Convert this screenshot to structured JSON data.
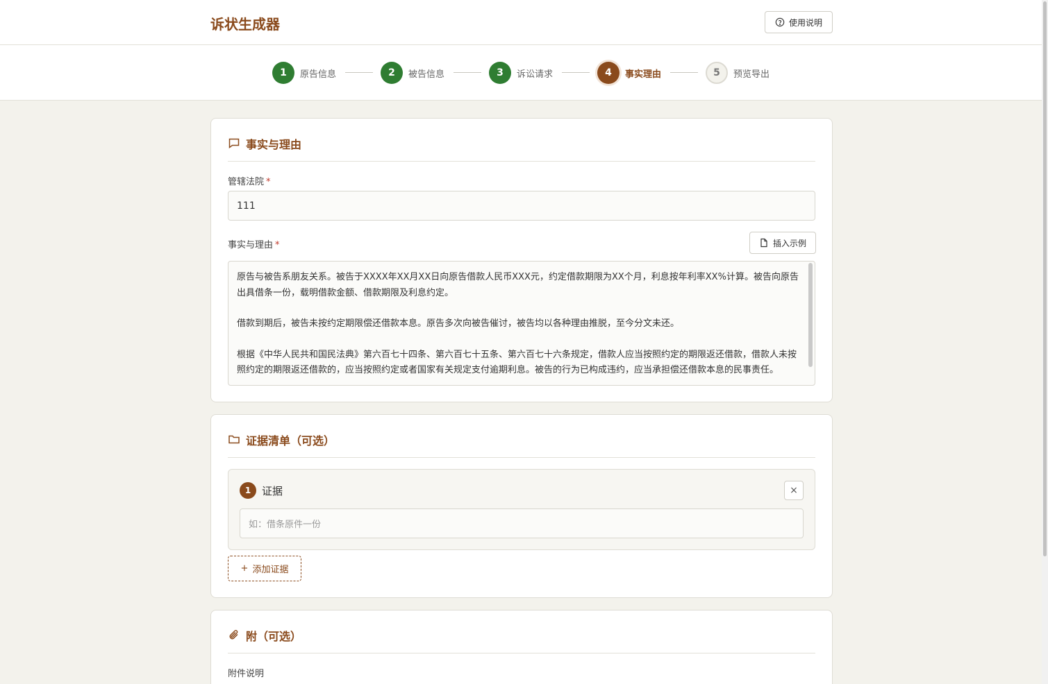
{
  "app": {
    "title": "诉状生成器",
    "help_label": "使用说明"
  },
  "steps": [
    {
      "num": "1",
      "label": "原告信息",
      "state": "done"
    },
    {
      "num": "2",
      "label": "被告信息",
      "state": "done"
    },
    {
      "num": "3",
      "label": "诉讼请求",
      "state": "done"
    },
    {
      "num": "4",
      "label": "事实理由",
      "state": "active"
    },
    {
      "num": "5",
      "label": "预览导出",
      "state": "pending"
    }
  ],
  "facts": {
    "section_title": "事实与理由",
    "court_label": "管辖法院",
    "court_value": "111",
    "reasons_label": "事实与理由",
    "insert_example_label": "插入示例",
    "reasons_paragraphs": [
      "原告与被告系朋友关系。被告于XXXX年XX月XX日向原告借款人民币XXX元，约定借款期限为XX个月，利息按年利率XX%计算。被告向原告出具借条一份，载明借款金额、借款期限及利息约定。",
      "借款到期后，被告未按约定期限偿还借款本息。原告多次向被告催讨，被告均以各种理由推脱，至今分文未还。",
      "根据《中华人民共和国民法典》第六百七十四条、第六百七十五条、第六百七十六条规定，借款人应当按照约定的期限返还借款，借款人未按照约定的期限返还借款的，应当按照约定或者国家有关规定支付逾期利息。被告的行为已构成违约，应当承担偿还借款本息的民事责任。"
    ]
  },
  "evidence": {
    "section_title": "证据清单（可选）",
    "items": [
      {
        "num": "1",
        "title": "证据",
        "placeholder": "如：借条原件一份"
      }
    ],
    "close_symbol": "×",
    "add_label": "添加证据",
    "add_symbol": "+"
  },
  "attachments": {
    "section_title": "附（可选）",
    "desc_label": "附件说明"
  },
  "required_mark": "*",
  "colors": {
    "brand": "#8a4a1c",
    "done": "#2f7d32",
    "background": "#f3f2ec"
  }
}
